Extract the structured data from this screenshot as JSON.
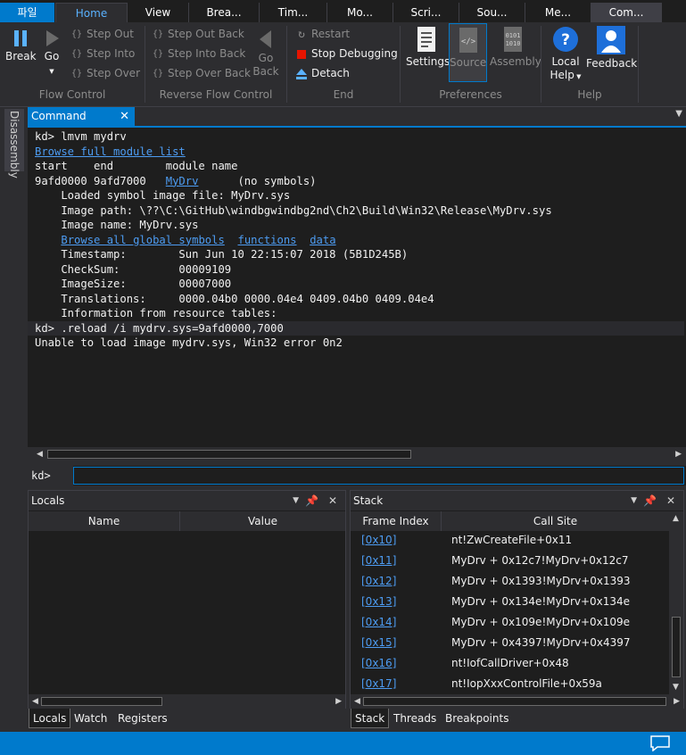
{
  "tabs": [
    "파일",
    "Home",
    "View",
    "Brea...",
    "Tim...",
    "Mo...",
    "Scri...",
    "Sou...",
    "Me...",
    "Com..."
  ],
  "ribbon": {
    "break": "Break",
    "go": "Go",
    "step_out": "Step Out",
    "step_into": "Step Into",
    "step_over": "Step Over",
    "step_out_back": "Step Out Back",
    "step_into_back": "Step Into Back",
    "step_over_back": "Step Over Back",
    "go_back_1": "Go",
    "go_back_2": "Back",
    "restart": "Restart",
    "stop_debugging": "Stop Debugging",
    "detach": "Detach",
    "settings": "Settings",
    "source": "Source",
    "assembly": "Assembly",
    "local_help_1": "Local",
    "local_help_2": "Help",
    "feedback": "Feedback",
    "groups": {
      "flow_control": "Flow Control",
      "reverse_flow_control": "Reverse Flow Control",
      "end": "End",
      "preferences": "Preferences",
      "help": "Help"
    }
  },
  "side_tab": "Disassembly",
  "command": {
    "title": "Command",
    "lines": [
      "kd> lmvm mydrv",
      "start    end        module name",
      "9afd0000 9afd7000   ",
      "    Loaded symbol image file: MyDrv.sys",
      "    Image path: \\??\\C:\\GitHub\\windbgwindbg2nd\\Ch2\\Build\\Win32\\Release\\MyDrv.sys",
      "    Image name: MyDrv.sys",
      "    Timestamp:        Sun Jun 10 22:15:07 2018 (5B1D245B)",
      "    CheckSum:         00009109",
      "    ImageSize:        00007000",
      "    Translations:     0000.04b0 0000.04e4 0409.04b0 0409.04e4",
      "    Information from resource tables:",
      "kd> .reload /i mydrv.sys=9afd0000,7000",
      "Unable to load image mydrv.sys, Win32 error 0n2"
    ],
    "browse_module_list": "Browse full module list",
    "module_link": "MyDrv",
    "no_symbols": "      (no symbols)",
    "browse_global_symbols": "Browse all global symbols",
    "functions": "functions",
    "data_link": "data",
    "prompt": "kd>",
    "input_value": ""
  },
  "locals": {
    "title": "Locals",
    "col_name": "Name",
    "col_value": "Value",
    "tabs": [
      "Locals",
      "Watch",
      "Registers"
    ]
  },
  "stack": {
    "title": "Stack",
    "col_frame": "Frame Index",
    "col_call": "Call Site",
    "rows": [
      {
        "frame": "[0x10]",
        "call": "nt!ZwCreateFile+0x11"
      },
      {
        "frame": "[0x11]",
        "call": "MyDrv + 0x12c7!MyDrv+0x12c7"
      },
      {
        "frame": "[0x12]",
        "call": "MyDrv + 0x1393!MyDrv+0x1393"
      },
      {
        "frame": "[0x13]",
        "call": "MyDrv + 0x134e!MyDrv+0x134e"
      },
      {
        "frame": "[0x14]",
        "call": "MyDrv + 0x109e!MyDrv+0x109e"
      },
      {
        "frame": "[0x15]",
        "call": "MyDrv + 0x4397!MyDrv+0x4397"
      },
      {
        "frame": "[0x16]",
        "call": "nt!IofCallDriver+0x48"
      },
      {
        "frame": "[0x17]",
        "call": "nt!IopXxxControlFile+0x59a"
      }
    ],
    "tabs": [
      "Stack",
      "Threads",
      "Breakpoints"
    ]
  },
  "colors": {
    "accent": "#007acc",
    "background": "#1e1e1e",
    "chrome": "#2d2d30",
    "link": "#4d9cf2",
    "stop": "#e51400"
  }
}
